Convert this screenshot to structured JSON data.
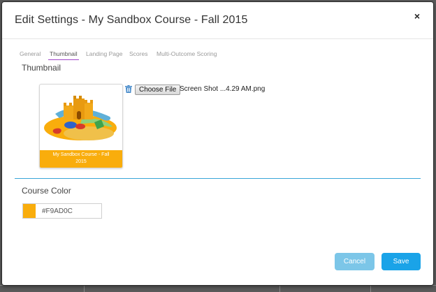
{
  "dialog": {
    "title": "Edit Settings - My Sandbox Course - Fall 2015",
    "close_label": "×"
  },
  "tabs": [
    {
      "label": "General",
      "active": false
    },
    {
      "label": "Thumbnail",
      "active": true
    },
    {
      "label": "Landing Page",
      "active": false
    },
    {
      "label": "Scores",
      "active": false
    },
    {
      "label": "Multi-Outcome Scoring",
      "active": false
    }
  ],
  "thumbnail": {
    "heading": "Thumbnail",
    "card_label": "My Sandbox Course - Fall 2015",
    "choose_file_label": "Choose File",
    "file_name": "Screen Shot ...4.29 AM.png",
    "delete_icon": "trash-icon"
  },
  "course_color": {
    "heading": "Course Color",
    "value": "#F9AD0C"
  },
  "buttons": {
    "cancel": "Cancel",
    "save": "Save"
  },
  "colors": {
    "accent": "#F9AD0C",
    "primary_button": "#1aa3e8",
    "cancel_button": "#7cc6e8",
    "divider": "#39a6d8",
    "active_tab_underline": "#9e47c9"
  }
}
